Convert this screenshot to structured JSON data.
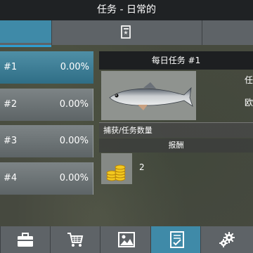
{
  "title": "任务 - 日常的",
  "tabs": [
    {
      "icon": "blank"
    },
    {
      "icon": "certificate-star-icon"
    },
    {
      "icon": "blank"
    }
  ],
  "tasks": [
    {
      "label": "#1",
      "progress": "0.00%"
    },
    {
      "label": "#2",
      "progress": "0.00%"
    },
    {
      "label": "#3",
      "progress": "0.00%"
    },
    {
      "label": "#4",
      "progress": "0.00%"
    }
  ],
  "detail": {
    "header": "每日任务 #1",
    "line1": "任",
    "line2": "欧",
    "catch_label": "捕获/任务数量",
    "reward_header": "报酬",
    "reward_value": "2"
  },
  "bottom_nav": [
    "tackle-box-icon",
    "cart-icon",
    "image-icon",
    "quest-icon",
    "gear-icon"
  ],
  "colors": {
    "accent": "#3f8aa8",
    "underline": "#2f9ed0",
    "bar": "#5e6367",
    "title": "#1f2224"
  }
}
